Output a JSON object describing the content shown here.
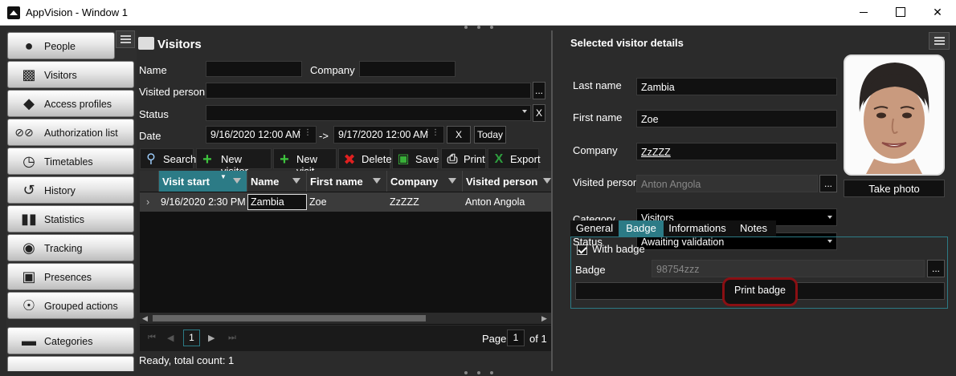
{
  "window": {
    "title": "AppVision - Window 1"
  },
  "sidebar": {
    "items": [
      {
        "label": "People",
        "icon": "person-icon"
      },
      {
        "label": "Visitors",
        "icon": "visitor-badge-icon"
      },
      {
        "label": "Access profiles",
        "icon": "access-profile-icon"
      },
      {
        "label": "Authorization list",
        "icon": "authorization-icon"
      },
      {
        "label": "Timetables",
        "icon": "clock-icon"
      },
      {
        "label": "History",
        "icon": "history-icon"
      },
      {
        "label": "Statistics",
        "icon": "bar-chart-icon"
      },
      {
        "label": "Tracking",
        "icon": "location-pin-icon"
      },
      {
        "label": "Presences",
        "icon": "presence-icon"
      },
      {
        "label": "Grouped actions",
        "icon": "grouped-actions-icon"
      },
      {
        "label": "Categories",
        "icon": "categories-icon"
      }
    ]
  },
  "visitors": {
    "title": "Visitors",
    "filters": {
      "name_label": "Name",
      "name_value": "",
      "company_label": "Company",
      "company_value": "",
      "visited_label": "Visited person",
      "visited_value": "",
      "status_label": "Status",
      "status_value": "",
      "date_label": "Date",
      "date_from": "9/16/2020 12:00 AM",
      "date_sep": "->",
      "date_to": "9/17/2020 12:00 AM",
      "clear_label": "X",
      "today_label": "Today",
      "browse_label": "...",
      "status_clear": "X"
    },
    "toolbar": {
      "search": "Search",
      "new_visitor": "New visitor",
      "new_visit": "New visit",
      "delete": "Delete",
      "save": "Save",
      "print": "Print",
      "export": "Export"
    },
    "grid": {
      "columns": [
        "Visit start",
        "Name",
        "First name",
        "Company",
        "Visited person"
      ],
      "rows": [
        [
          "9/16/2020 2:30 PM",
          "Zambia",
          "Zoe",
          "ZzZZZ",
          "Anton Angola"
        ]
      ]
    },
    "pager": {
      "current": "1",
      "page_label": "Page",
      "page_value": "1",
      "of_label": "of 1"
    },
    "status": "Ready, total count: 1"
  },
  "details": {
    "title": "Selected visitor details",
    "last_name_label": "Last name",
    "last_name": "Zambia",
    "first_name_label": "First name",
    "first_name": "Zoe",
    "company_label": "Company",
    "company": "ZzZZZ",
    "visited_label": "Visited person",
    "visited": "Anton Angola",
    "category_label": "Category",
    "category": "Visitors",
    "status_label": "Status",
    "status": "Awaiting validation",
    "take_photo": "Take photo",
    "browse": "...",
    "tabs": [
      "General",
      "Badge",
      "Informations",
      "Notes"
    ],
    "active_tab": "Badge",
    "with_badge_label": "With badge",
    "with_badge": true,
    "badge_label": "Badge",
    "badge_value": "98754zzz",
    "print_badge": "Print badge"
  },
  "colors": {
    "accent": "#2c7b86",
    "highlight": "#8a0f13",
    "background": "#2b2b2b"
  }
}
